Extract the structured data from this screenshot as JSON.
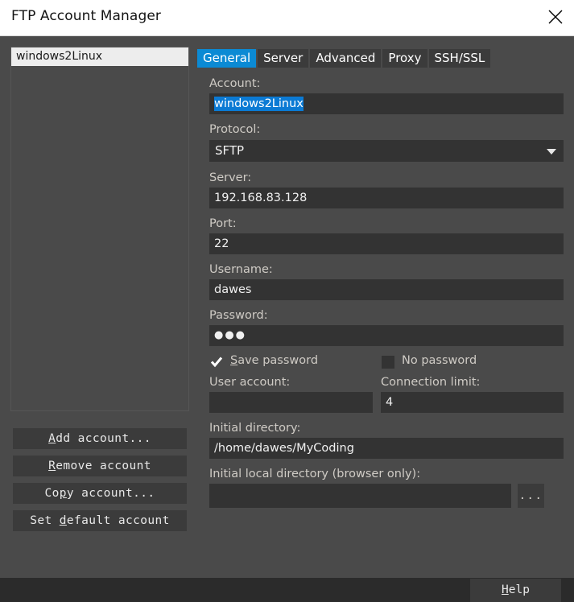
{
  "window": {
    "title": "FTP Account Manager",
    "close_icon": "close-icon"
  },
  "sidebar": {
    "accounts": [
      "windows2Linux"
    ],
    "buttons": [
      {
        "label_pre": "",
        "mnemonic": "A",
        "label_post": "dd account..."
      },
      {
        "label_pre": "",
        "mnemonic": "R",
        "label_post": "emove account"
      },
      {
        "label_pre": "Co",
        "mnemonic": "p",
        "label_post": "y account..."
      },
      {
        "label_pre": "Set ",
        "mnemonic": "d",
        "label_post": "efault account"
      }
    ]
  },
  "tabs": [
    {
      "label": "General",
      "active": true
    },
    {
      "label": "Server",
      "active": false
    },
    {
      "label": "Advanced",
      "active": false
    },
    {
      "label": "Proxy",
      "active": false
    },
    {
      "label": "SSH/SSL",
      "active": false
    }
  ],
  "form": {
    "account_label": "Account:",
    "account_value": "windows2Linux",
    "protocol_label": "Protocol:",
    "protocol_value": "SFTP",
    "protocol_options": [
      "SFTP"
    ],
    "server_label": "Server:",
    "server_value": "192.168.83.128",
    "port_label": "Port:",
    "port_value": "22",
    "username_label": "Username:",
    "username_value": "dawes",
    "password_label": "Password:",
    "password_value": "●●●",
    "save_password": {
      "pre": "",
      "mnemonic": "S",
      "post": "ave password",
      "checked": true
    },
    "no_password": {
      "label": "No password",
      "checked": false
    },
    "user_account_label": "User account:",
    "user_account_value": "",
    "user_account_placeholder": "",
    "connection_limit_label": "Connection limit:",
    "connection_limit_value": "4",
    "initial_directory_label": "Initial directory:",
    "initial_directory_value": "/home/dawes/MyCoding",
    "initial_local_directory_label": "Initial local directory (browser only):",
    "initial_local_directory_value": "",
    "browse_button_label": "..."
  },
  "footer": {
    "help_pre": "",
    "help_mnemonic": "H",
    "help_post": "elp"
  },
  "colors": {
    "accent_blue": "#0b8ad4",
    "selection_blue": "#0b7ad4",
    "window_bg": "#4a4a4a",
    "field_bg": "#333333",
    "button_bg": "#3b3b3b",
    "titlebar_bg": "#ffffff"
  }
}
